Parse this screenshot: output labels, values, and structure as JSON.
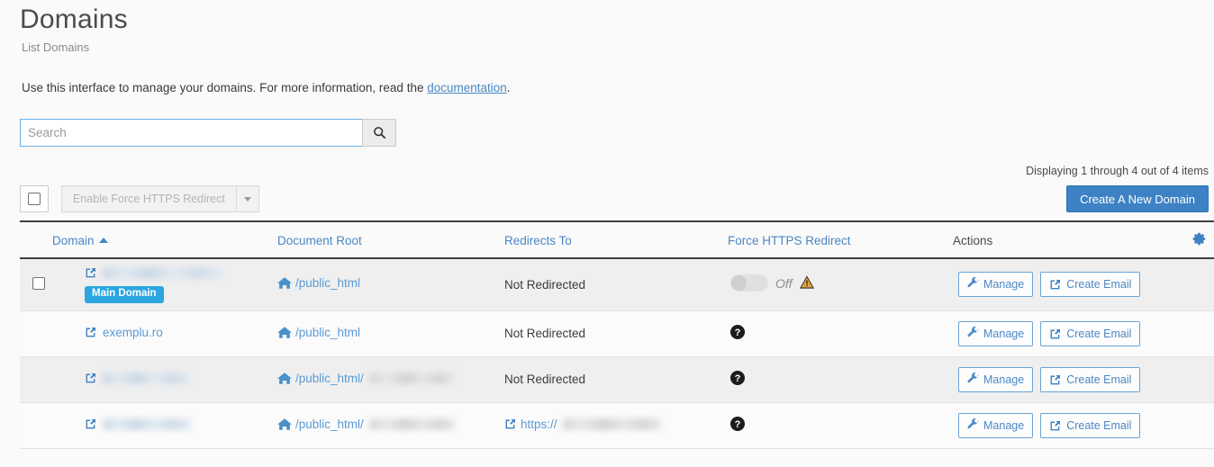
{
  "header": {
    "title": "Domains",
    "subtitle": "List Domains",
    "intro_before": "Use this interface to manage your domains. For more information, read the ",
    "intro_link": "documentation",
    "intro_after": "."
  },
  "search": {
    "placeholder": "Search",
    "value": "",
    "icon": "search-icon"
  },
  "counter": "Displaying 1 through 4 out of 4 items",
  "toolbar": {
    "select_all_checked": false,
    "bulk_action_label": "Enable Force HTTPS Redirect",
    "bulk_action_disabled": true,
    "caret_icon": "chevron-down-icon",
    "create_button": "Create A New Domain"
  },
  "table": {
    "columns": {
      "domain": "Domain",
      "document_root": "Document Root",
      "redirects_to": "Redirects To",
      "force_https": "Force HTTPS Redirect",
      "actions": "Actions"
    },
    "sort": {
      "column": "domain",
      "direction": "asc",
      "icon": "chevron-up-icon"
    },
    "settings_icon": "gear-icon",
    "rows": [
      {
        "has_checkbox": true,
        "checkbox_checked": false,
        "domain": "",
        "domain_redacted": true,
        "domain_redacted_width": 136,
        "badge": "Main Domain",
        "document_root_prefix": "/public_html",
        "document_root_redacted": false,
        "document_root_redacted_width": 0,
        "redirects_to": "Not Redirected",
        "redirects_to_is_link": false,
        "redirect_redacted_width": 0,
        "force_https_type": "toggle",
        "force_https_label": "Off",
        "force_https_warning": true,
        "actions": [
          "Manage",
          "Create Email"
        ],
        "striped": true
      },
      {
        "has_checkbox": false,
        "checkbox_checked": false,
        "domain": "exemplu.ro",
        "domain_redacted": false,
        "domain_redacted_width": 0,
        "badge": "",
        "document_root_prefix": "/public_html",
        "document_root_redacted": false,
        "document_root_redacted_width": 0,
        "redirects_to": "Not Redirected",
        "redirects_to_is_link": false,
        "redirect_redacted_width": 0,
        "force_https_type": "help",
        "force_https_label": "",
        "force_https_warning": false,
        "actions": [
          "Manage",
          "Create Email"
        ],
        "striped": false
      },
      {
        "has_checkbox": false,
        "checkbox_checked": false,
        "domain": "",
        "domain_redacted": true,
        "domain_redacted_width": 99,
        "badge": "",
        "document_root_prefix": "/public_html/",
        "document_root_redacted": true,
        "document_root_redacted_width": 96,
        "redirects_to": "Not Redirected",
        "redirects_to_is_link": false,
        "redirect_redacted_width": 0,
        "force_https_type": "help",
        "force_https_label": "",
        "force_https_warning": false,
        "actions": [
          "Manage",
          "Create Email"
        ],
        "striped": true
      },
      {
        "has_checkbox": false,
        "checkbox_checked": false,
        "domain": "",
        "domain_redacted": true,
        "domain_redacted_width": 99,
        "badge": "",
        "document_root_prefix": "/public_html/",
        "document_root_redacted": true,
        "document_root_redacted_width": 96,
        "redirects_to": "https://",
        "redirects_to_is_link": true,
        "redirect_redacted_width": 110,
        "force_https_type": "help",
        "force_https_label": "",
        "force_https_warning": false,
        "actions": [
          "Manage",
          "Create Email"
        ],
        "striped": false
      }
    ]
  },
  "icons": {
    "external_link": "external-link-icon",
    "home": "home-icon",
    "wrench": "wrench-icon",
    "warning": "warning-triangle-icon",
    "help": "help-circle-icon"
  },
  "colors": {
    "accent": "#3d82c4",
    "link": "#5b9bd5",
    "badge": "#2ba6de",
    "page_bg": "#fafafa",
    "stripe": "#efefef"
  }
}
